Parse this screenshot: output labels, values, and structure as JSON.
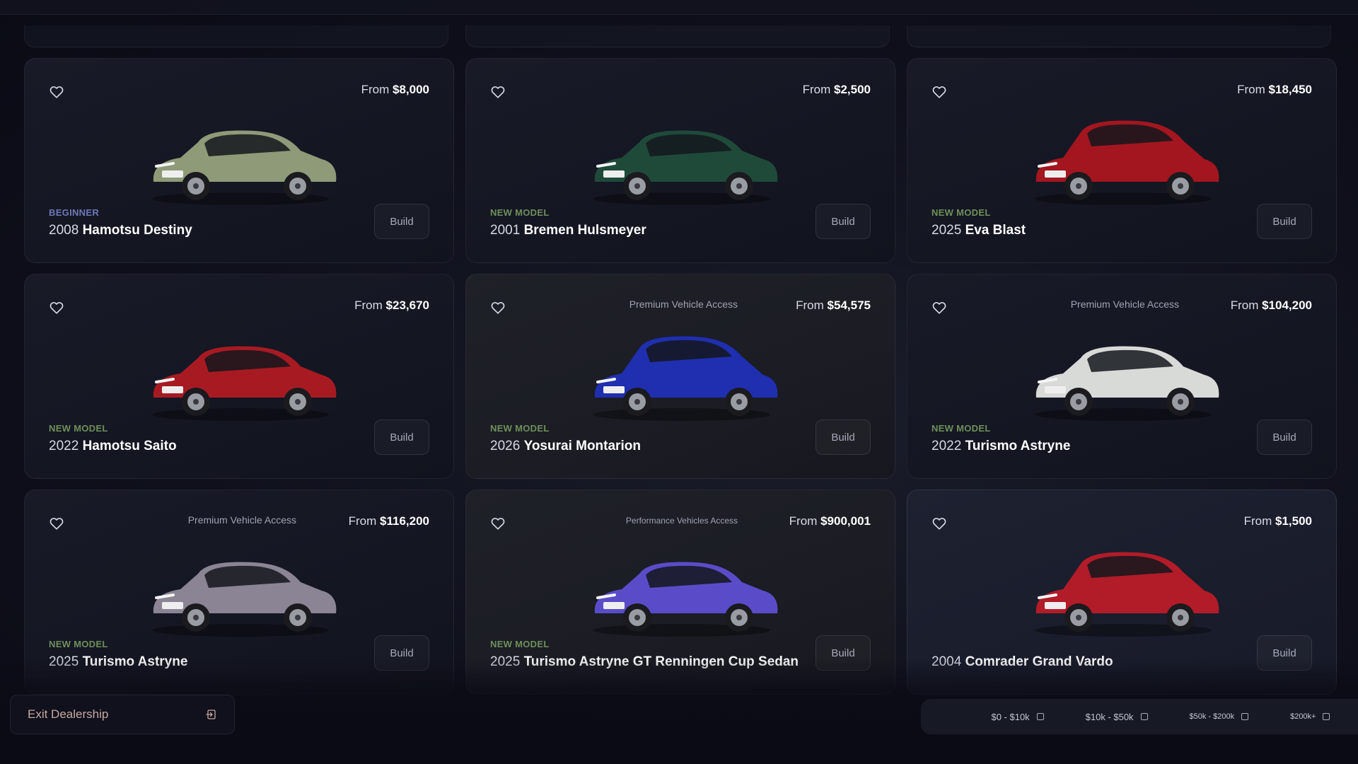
{
  "cards": [
    {
      "access": "",
      "price_prefix": "From",
      "price": "$8,000",
      "tag": "BEGINNER",
      "year": "2008",
      "model": "Hamotsu Destiny",
      "build": "Build",
      "color": "#8f9a78"
    },
    {
      "access": "",
      "price_prefix": "From",
      "price": "$2,500",
      "tag": "NEW MODEL",
      "year": "2001",
      "model": "Bremen Hulsmeyer",
      "build": "Build",
      "color": "#1f4a3a"
    },
    {
      "access": "",
      "price_prefix": "From",
      "price": "$18,450",
      "tag": "NEW MODEL",
      "year": "2025",
      "model": "Eva Blast",
      "build": "Build",
      "color": "#a3161f"
    },
    {
      "access": "",
      "price_prefix": "From",
      "price": "$23,670",
      "tag": "NEW MODEL",
      "year": "2022",
      "model": "Hamotsu Saito",
      "build": "Build",
      "color": "#a81a22"
    },
    {
      "access": "Premium Vehicle Access",
      "price_prefix": "From",
      "price": "$54,575",
      "tag": "NEW MODEL",
      "year": "2026",
      "model": "Yosurai Montarion",
      "build": "Build",
      "color": "#1f2fb0"
    },
    {
      "access": "Premium Vehicle Access",
      "price_prefix": "From",
      "price": "$104,200",
      "tag": "NEW MODEL",
      "year": "2022",
      "model": "Turismo Astryne",
      "build": "Build",
      "color": "#d8dad8"
    },
    {
      "access": "Premium Vehicle Access",
      "price_prefix": "From",
      "price": "$116,200",
      "tag": "NEW MODEL",
      "year": "2025",
      "model": "Turismo Astryne",
      "build": "Build",
      "color": "#8a8494"
    },
    {
      "access": "Performance Vehicles Access",
      "price_prefix": "From",
      "price": "$900,001",
      "tag": "NEW MODEL",
      "year": "2025",
      "model": "Turismo Astryne GT Renningen Cup Sedan",
      "build": "Build",
      "color": "#5a4cc8"
    },
    {
      "access": "",
      "price_prefix": "From",
      "price": "$1,500",
      "tag": "",
      "year": "2004",
      "model": "Comrader Grand Vardo",
      "build": "Build",
      "color": "#b11c28"
    }
  ],
  "exit": {
    "label": "Exit Dealership"
  },
  "filters": [
    "$0 - $10k",
    "$10k - $50k",
    "$50k - $200k",
    "$200k+"
  ],
  "colors": {
    "tag_beginner": "#6d78b8",
    "tag_new_model": "#6e8f5a",
    "background": "#0d0e19"
  }
}
